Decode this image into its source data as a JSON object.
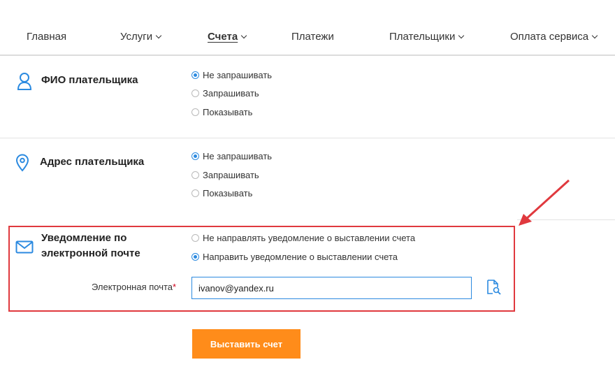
{
  "nav": {
    "items": [
      {
        "label": "Главная",
        "has_dropdown": false,
        "active": false
      },
      {
        "label": "Услуги",
        "has_dropdown": true,
        "active": false
      },
      {
        "label": "Счета",
        "has_dropdown": true,
        "active": true
      },
      {
        "label": "Платежи",
        "has_dropdown": false,
        "active": false
      },
      {
        "label": "Плательщики",
        "has_dropdown": true,
        "active": false
      },
      {
        "label": "Оплата сервиса",
        "has_dropdown": true,
        "active": false
      }
    ]
  },
  "sections": {
    "payer_name": {
      "title": "ФИО плательщика",
      "icon": "person-icon",
      "options": [
        {
          "label": "Не запрашивать",
          "checked": true
        },
        {
          "label": "Запрашивать",
          "checked": false
        },
        {
          "label": "Показывать",
          "checked": false
        }
      ]
    },
    "payer_address": {
      "title": "Адрес плательщика",
      "icon": "location-pin-icon",
      "options": [
        {
          "label": "Не запрашивать",
          "checked": true
        },
        {
          "label": "Запрашивать",
          "checked": false
        },
        {
          "label": "Показывать",
          "checked": false
        }
      ]
    },
    "email_notification": {
      "title_line1": "Уведомление по",
      "title_line2": "электронной почте",
      "icon": "envelope-icon",
      "options": [
        {
          "label": "Не направлять уведомление о выставлении счета",
          "checked": false
        },
        {
          "label": "Направить уведомление о выставлении счета",
          "checked": true
        }
      ],
      "email_label": "Электронная почта",
      "required_mark": "*",
      "email_value": "ivanov@yandex.ru"
    }
  },
  "submit_label": "Выставить счет",
  "colors": {
    "accent": "#2b8ae0",
    "button": "#ff8c1a",
    "annotation": "#e0393e"
  }
}
